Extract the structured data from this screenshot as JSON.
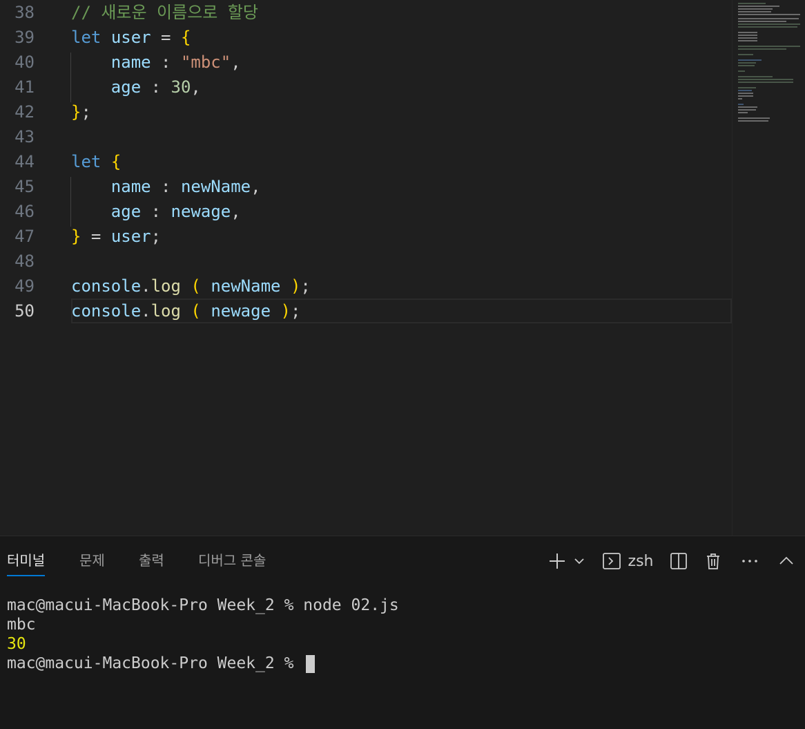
{
  "editor": {
    "line_numbers": [
      "38",
      "39",
      "40",
      "41",
      "42",
      "43",
      "44",
      "45",
      "46",
      "47",
      "48",
      "49",
      "50"
    ],
    "active_line": "50",
    "lines": {
      "l38_comment": "// 새로운 이름으로 할당",
      "l39_let": "let",
      "l39_user": "user",
      "l39_eq": " = ",
      "l39_brace": "{",
      "l40_key": "name",
      "l40_colon": " : ",
      "l40_value": "\"mbc\"",
      "l40_comma": ",",
      "l41_key": "age",
      "l41_colon": " : ",
      "l41_value": "30",
      "l41_comma": ",",
      "l42_brace": "}",
      "l42_semi": ";",
      "l44_let": "let",
      "l44_brace": "{",
      "l45_key": "name",
      "l45_colon": " : ",
      "l45_value": "newName",
      "l45_comma": ",",
      "l46_key": "age",
      "l46_colon": " : ",
      "l46_value": "newage",
      "l46_comma": ",",
      "l47_brace": "}",
      "l47_eq": " = ",
      "l47_user": "user",
      "l47_semi": ";",
      "l49_console": "console",
      "l49_dot": ".",
      "l49_log": "log",
      "l49_open": "(",
      "l49_arg": "newName",
      "l49_close": ")",
      "l49_semi": ";",
      "l50_console": "console",
      "l50_dot": ".",
      "l50_log": "log",
      "l50_open": "(",
      "l50_arg": "newage",
      "l50_close": ")",
      "l50_semi": ";"
    }
  },
  "panel": {
    "tabs": [
      {
        "label": "터미널",
        "active": true
      },
      {
        "label": "문제",
        "active": false
      },
      {
        "label": "출력",
        "active": false
      },
      {
        "label": "디버그 콘솔",
        "active": false
      }
    ],
    "toolbar": {
      "add_icon": "plus-icon",
      "dropdown_icon": "chevron-down-icon",
      "shell_icon": "terminal-icon",
      "shell_label": "zsh",
      "split_icon": "split-icon",
      "trash_icon": "trash-icon",
      "more_icon": "ellipsis-icon",
      "maximize_icon": "chevron-up-icon"
    },
    "terminal": {
      "lines": [
        "mac@macui-MacBook-Pro Week_2 % node 02.js",
        "mbc",
        "30",
        "mac@macui-MacBook-Pro Week_2 % "
      ]
    }
  },
  "colors": {
    "keyword": "#569cd6",
    "variable": "#9cdcfe",
    "string": "#ce9178",
    "number": "#b5cea8",
    "function": "#dcdcaa",
    "comment": "#6a9955",
    "bracket": "#ffd700",
    "terminal_yellow": "#e5e510",
    "tab_accent": "#0078d4"
  }
}
